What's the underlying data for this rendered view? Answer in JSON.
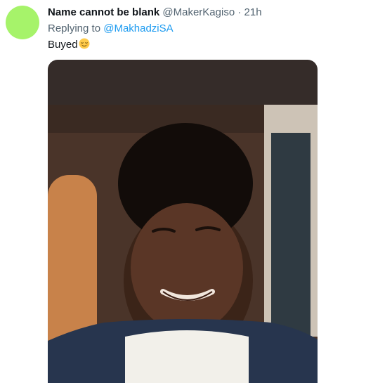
{
  "tweet": {
    "author_name": "Name cannot be blank",
    "handle": "@MakerKagiso",
    "separator": "·",
    "time": "21h",
    "replying_prefix": "Replying to",
    "replying_to": "@MakhadziSA",
    "text": "Buyed",
    "text_emoji": "relieved-face-emoji"
  },
  "avatar": {
    "color": "#a6f36a"
  },
  "colors": {
    "link": "#1d9bf0",
    "muted": "#536471",
    "text": "#0f1419",
    "media_background": "#352c29"
  }
}
